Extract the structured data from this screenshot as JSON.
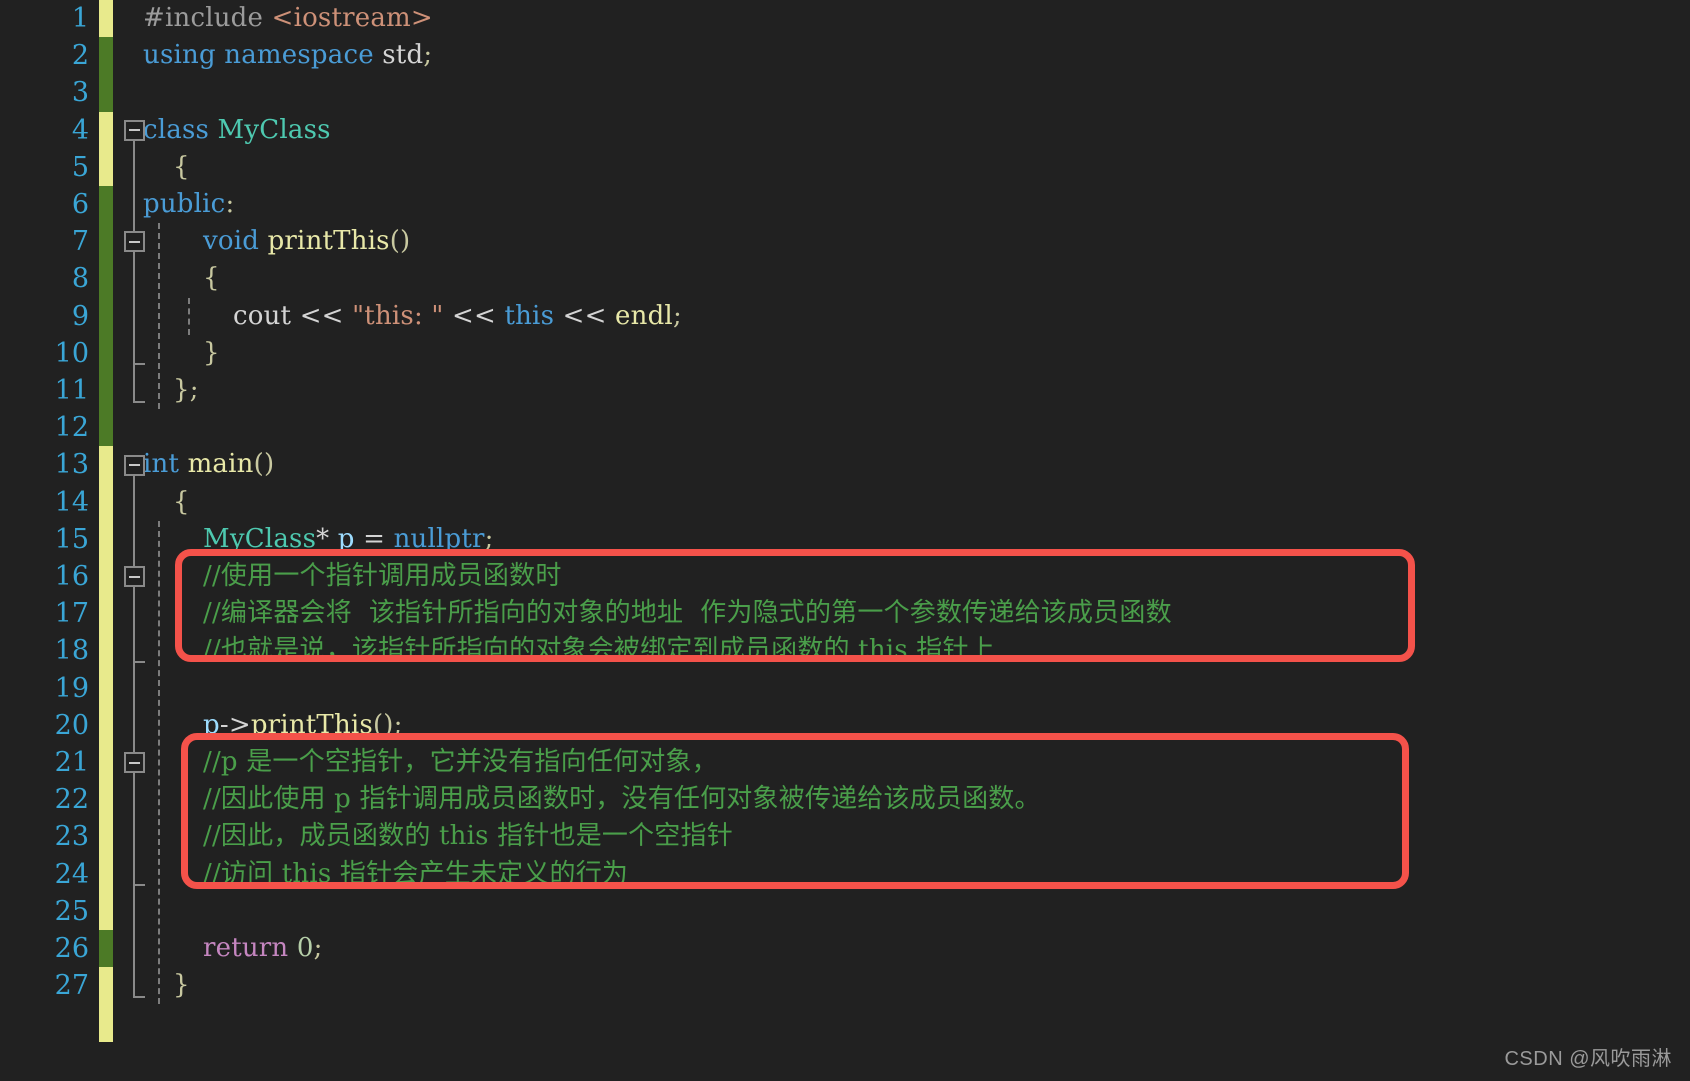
{
  "editor": {
    "background": "#212121",
    "line_number_color": "#3aa6d6",
    "first_line": 1,
    "total_visible_lines": 28,
    "line_height_px": 37.2
  },
  "gutter": {
    "line_numbers": [
      "1",
      "2",
      "3",
      "4",
      "5",
      "6",
      "7",
      "8",
      "9",
      "10",
      "11",
      "12",
      "13",
      "14",
      "15",
      "16",
      "17",
      "18",
      "19",
      "20",
      "21",
      "22",
      "23",
      "24",
      "25",
      "26",
      "27"
    ],
    "change_bar_colors": {
      "modified": "#e8ea8c",
      "saved": "#4c7a26"
    }
  },
  "annotations": {
    "highlight_color": "#f4524a",
    "boxes": [
      {
        "label": "comment-block-1",
        "first_line": 16,
        "last_line": 18
      },
      {
        "label": "comment-block-2",
        "first_line": 21,
        "last_line": 24
      }
    ]
  },
  "watermark": {
    "text": "CSDN @风吹雨淋"
  },
  "code": {
    "lines": [
      {
        "n": 1,
        "indent": 0,
        "text": "#include <iostream>",
        "tokens": [
          {
            "t": "#include ",
            "c": "pre"
          },
          {
            "t": "<iostream>",
            "c": "str"
          }
        ]
      },
      {
        "n": 2,
        "indent": 0,
        "text": "using namespace std;",
        "tokens": [
          {
            "t": "using",
            "c": "kw"
          },
          {
            "t": " ",
            "c": "plain"
          },
          {
            "t": "namespace",
            "c": "kw"
          },
          {
            "t": " ",
            "c": "plain"
          },
          {
            "t": "std",
            "c": "plain"
          },
          {
            "t": ";",
            "c": "punc"
          }
        ]
      },
      {
        "n": 3,
        "indent": 0,
        "text": "",
        "tokens": []
      },
      {
        "n": 4,
        "indent": 0,
        "text": "class MyClass",
        "tokens": [
          {
            "t": "class",
            "c": "kw"
          },
          {
            "t": " ",
            "c": "plain"
          },
          {
            "t": "MyClass",
            "c": "type"
          }
        ]
      },
      {
        "n": 5,
        "indent": 1,
        "text": "{",
        "tokens": [
          {
            "t": "{",
            "c": "punc"
          }
        ]
      },
      {
        "n": 6,
        "indent": 0,
        "text": "public:",
        "tokens": [
          {
            "t": "public",
            "c": "kw"
          },
          {
            "t": ":",
            "c": "punc"
          }
        ]
      },
      {
        "n": 7,
        "indent": 2,
        "text": "void printThis()",
        "tokens": [
          {
            "t": "void",
            "c": "kw"
          },
          {
            "t": " ",
            "c": "plain"
          },
          {
            "t": "printThis",
            "c": "fn"
          },
          {
            "t": "()",
            "c": "punc"
          }
        ]
      },
      {
        "n": 8,
        "indent": 2,
        "text": "{",
        "tokens": [
          {
            "t": "{",
            "c": "punc"
          }
        ]
      },
      {
        "n": 9,
        "indent": 3,
        "text": "cout << \"this: \" << this << endl;",
        "tokens": [
          {
            "t": "cout",
            "c": "plain"
          },
          {
            "t": " ",
            "c": "plain"
          },
          {
            "t": "<<",
            "c": "op"
          },
          {
            "t": " ",
            "c": "plain"
          },
          {
            "t": "\"this: \"",
            "c": "str"
          },
          {
            "t": " ",
            "c": "plain"
          },
          {
            "t": "<<",
            "c": "op"
          },
          {
            "t": " ",
            "c": "plain"
          },
          {
            "t": "this",
            "c": "kw"
          },
          {
            "t": " ",
            "c": "plain"
          },
          {
            "t": "<<",
            "c": "op"
          },
          {
            "t": " ",
            "c": "plain"
          },
          {
            "t": "endl",
            "c": "fn"
          },
          {
            "t": ";",
            "c": "punc"
          }
        ]
      },
      {
        "n": 10,
        "indent": 2,
        "text": "}",
        "tokens": [
          {
            "t": "}",
            "c": "punc"
          }
        ]
      },
      {
        "n": 11,
        "indent": 1,
        "text": "};",
        "tokens": [
          {
            "t": "};",
            "c": "punc"
          }
        ]
      },
      {
        "n": 12,
        "indent": 0,
        "text": "",
        "tokens": []
      },
      {
        "n": 13,
        "indent": 0,
        "text": "int main()",
        "tokens": [
          {
            "t": "int",
            "c": "kw"
          },
          {
            "t": " ",
            "c": "plain"
          },
          {
            "t": "main",
            "c": "fn"
          },
          {
            "t": "()",
            "c": "punc"
          }
        ]
      },
      {
        "n": 14,
        "indent": 1,
        "text": "{",
        "tokens": [
          {
            "t": "{",
            "c": "punc"
          }
        ]
      },
      {
        "n": 15,
        "indent": 2,
        "text": "MyClass* p = nullptr;",
        "tokens": [
          {
            "t": "MyClass",
            "c": "type"
          },
          {
            "t": "*",
            "c": "op"
          },
          {
            "t": " ",
            "c": "plain"
          },
          {
            "t": "p",
            "c": "var"
          },
          {
            "t": " ",
            "c": "plain"
          },
          {
            "t": "=",
            "c": "op"
          },
          {
            "t": " ",
            "c": "plain"
          },
          {
            "t": "nullptr",
            "c": "kw"
          },
          {
            "t": ";",
            "c": "punc"
          }
        ]
      },
      {
        "n": 16,
        "indent": 2,
        "text": "//使用一个指针调用成员函数时",
        "tokens": [
          {
            "t": "//使用一个指针调用成员函数时",
            "c": "comment"
          }
        ]
      },
      {
        "n": 17,
        "indent": 2,
        "text": "//编译器会将  该指针所指向的对象的地址  作为隐式的第一个参数传递给该成员函数",
        "tokens": [
          {
            "t": "//编译器会将  该指针所指向的对象的地址  作为隐式的第一个参数传递给该成员函数",
            "c": "comment"
          }
        ]
      },
      {
        "n": 18,
        "indent": 2,
        "text": "//也就是说，该指针所指向的对象会被绑定到成员函数的 this 指针上",
        "tokens": [
          {
            "t": "//也就是说，该指针所指向的对象会被绑定到成员函数的 this 指针上",
            "c": "comment"
          }
        ]
      },
      {
        "n": 19,
        "indent": 2,
        "text": "",
        "tokens": []
      },
      {
        "n": 20,
        "indent": 2,
        "text": "p->printThis();",
        "tokens": [
          {
            "t": "p",
            "c": "var"
          },
          {
            "t": "->",
            "c": "op"
          },
          {
            "t": "printThis",
            "c": "fn"
          },
          {
            "t": "()",
            "c": "punc"
          },
          {
            "t": ";",
            "c": "punc"
          }
        ]
      },
      {
        "n": 21,
        "indent": 2,
        "text": "//p 是一个空指针，它并没有指向任何对象，",
        "tokens": [
          {
            "t": "//p 是一个空指针，它并没有指向任何对象，",
            "c": "comment"
          }
        ]
      },
      {
        "n": 22,
        "indent": 2,
        "text": "//因此使用 p 指针调用成员函数时，没有任何对象被传递给该成员函数。",
        "tokens": [
          {
            "t": "//因此使用 p 指针调用成员函数时，没有任何对象被传递给该成员函数。",
            "c": "comment"
          }
        ]
      },
      {
        "n": 23,
        "indent": 2,
        "text": "//因此，成员函数的 this 指针也是一个空指针",
        "tokens": [
          {
            "t": "//因此，成员函数的 this 指针也是一个空指针",
            "c": "comment"
          }
        ]
      },
      {
        "n": 24,
        "indent": 2,
        "text": "//访问 this 指针会产生未定义的行为",
        "tokens": [
          {
            "t": "//访问 this 指针会产生未定义的行为",
            "c": "comment"
          }
        ]
      },
      {
        "n": 25,
        "indent": 2,
        "text": "",
        "tokens": []
      },
      {
        "n": 26,
        "indent": 2,
        "text": "return 0;",
        "tokens": [
          {
            "t": "return",
            "c": "ret"
          },
          {
            "t": " ",
            "c": "plain"
          },
          {
            "t": "0",
            "c": "num"
          },
          {
            "t": ";",
            "c": "punc"
          }
        ]
      },
      {
        "n": 27,
        "indent": 1,
        "text": "}",
        "tokens": [
          {
            "t": "}",
            "c": "punc"
          }
        ]
      }
    ]
  }
}
